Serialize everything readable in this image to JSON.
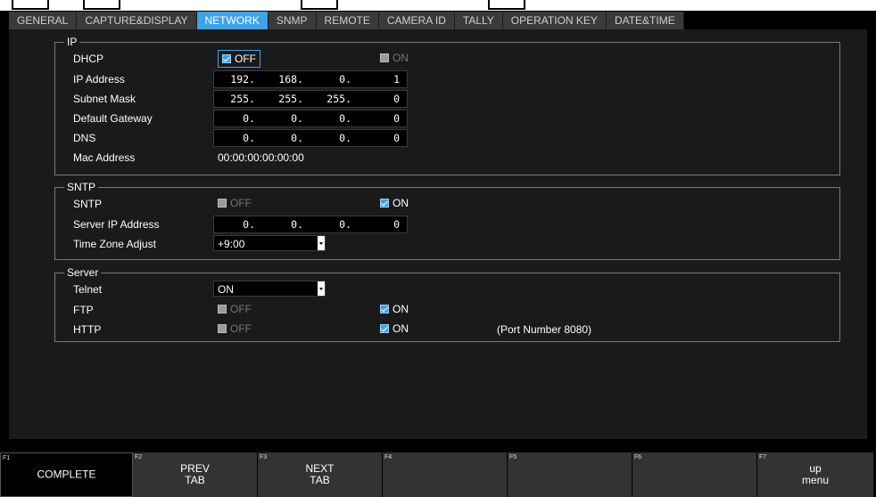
{
  "tabs": [
    {
      "label": "GENERAL",
      "active": false
    },
    {
      "label": "CAPTURE&DISPLAY",
      "active": false
    },
    {
      "label": "NETWORK",
      "active": true
    },
    {
      "label": "SNMP",
      "active": false
    },
    {
      "label": "REMOTE",
      "active": false
    },
    {
      "label": "CAMERA ID",
      "active": false
    },
    {
      "label": "TALLY",
      "active": false
    },
    {
      "label": "OPERATION KEY",
      "active": false
    },
    {
      "label": "DATE&TIME",
      "active": false
    }
  ],
  "ip": {
    "title": "IP",
    "dhcp": {
      "label": "DHCP",
      "off_label": "OFF",
      "on_label": "ON",
      "value": "OFF"
    },
    "ip_address": {
      "label": "IP Address",
      "octets": [
        "192.",
        "168.",
        "0.",
        "1"
      ]
    },
    "subnet_mask": {
      "label": "Subnet Mask",
      "octets": [
        "255.",
        "255.",
        "255.",
        "0"
      ]
    },
    "default_gateway": {
      "label": "Default Gateway",
      "octets": [
        "0.",
        "0.",
        "0.",
        "0"
      ]
    },
    "dns": {
      "label": "DNS",
      "octets": [
        "0.",
        "0.",
        "0.",
        "0"
      ]
    },
    "mac_address": {
      "label": "Mac Address",
      "value": "00:00:00:00:00:00"
    }
  },
  "sntp": {
    "title": "SNTP",
    "sntp": {
      "label": "SNTP",
      "off_label": "OFF",
      "on_label": "ON",
      "value": "ON"
    },
    "server_ip": {
      "label": "Server IP Address",
      "octets": [
        "0.",
        "0.",
        "0.",
        "0"
      ]
    },
    "time_zone": {
      "label": "Time Zone Adjust",
      "value": "+9:00"
    }
  },
  "server": {
    "title": "Server",
    "telnet": {
      "label": "Telnet",
      "value": "ON"
    },
    "ftp": {
      "label": "FTP",
      "off_label": "OFF",
      "on_label": "ON",
      "value": "ON"
    },
    "http": {
      "label": "HTTP",
      "off_label": "OFF",
      "on_label": "ON",
      "value": "ON",
      "note": "(Port Number 8080)"
    }
  },
  "fkeys": [
    {
      "fn": "F1",
      "label": "COMPLETE"
    },
    {
      "fn": "F2",
      "label": "PREV\nTAB"
    },
    {
      "fn": "F3",
      "label": "NEXT\nTAB"
    },
    {
      "fn": "F4",
      "label": ""
    },
    {
      "fn": "F5",
      "label": ""
    },
    {
      "fn": "F6",
      "label": ""
    },
    {
      "fn": "F7",
      "label": "up\nmenu"
    }
  ],
  "colors": {
    "accent": "#3da3e8",
    "tab_bg": "#3a3a3a",
    "panel_bg": "#1a1a1a"
  }
}
